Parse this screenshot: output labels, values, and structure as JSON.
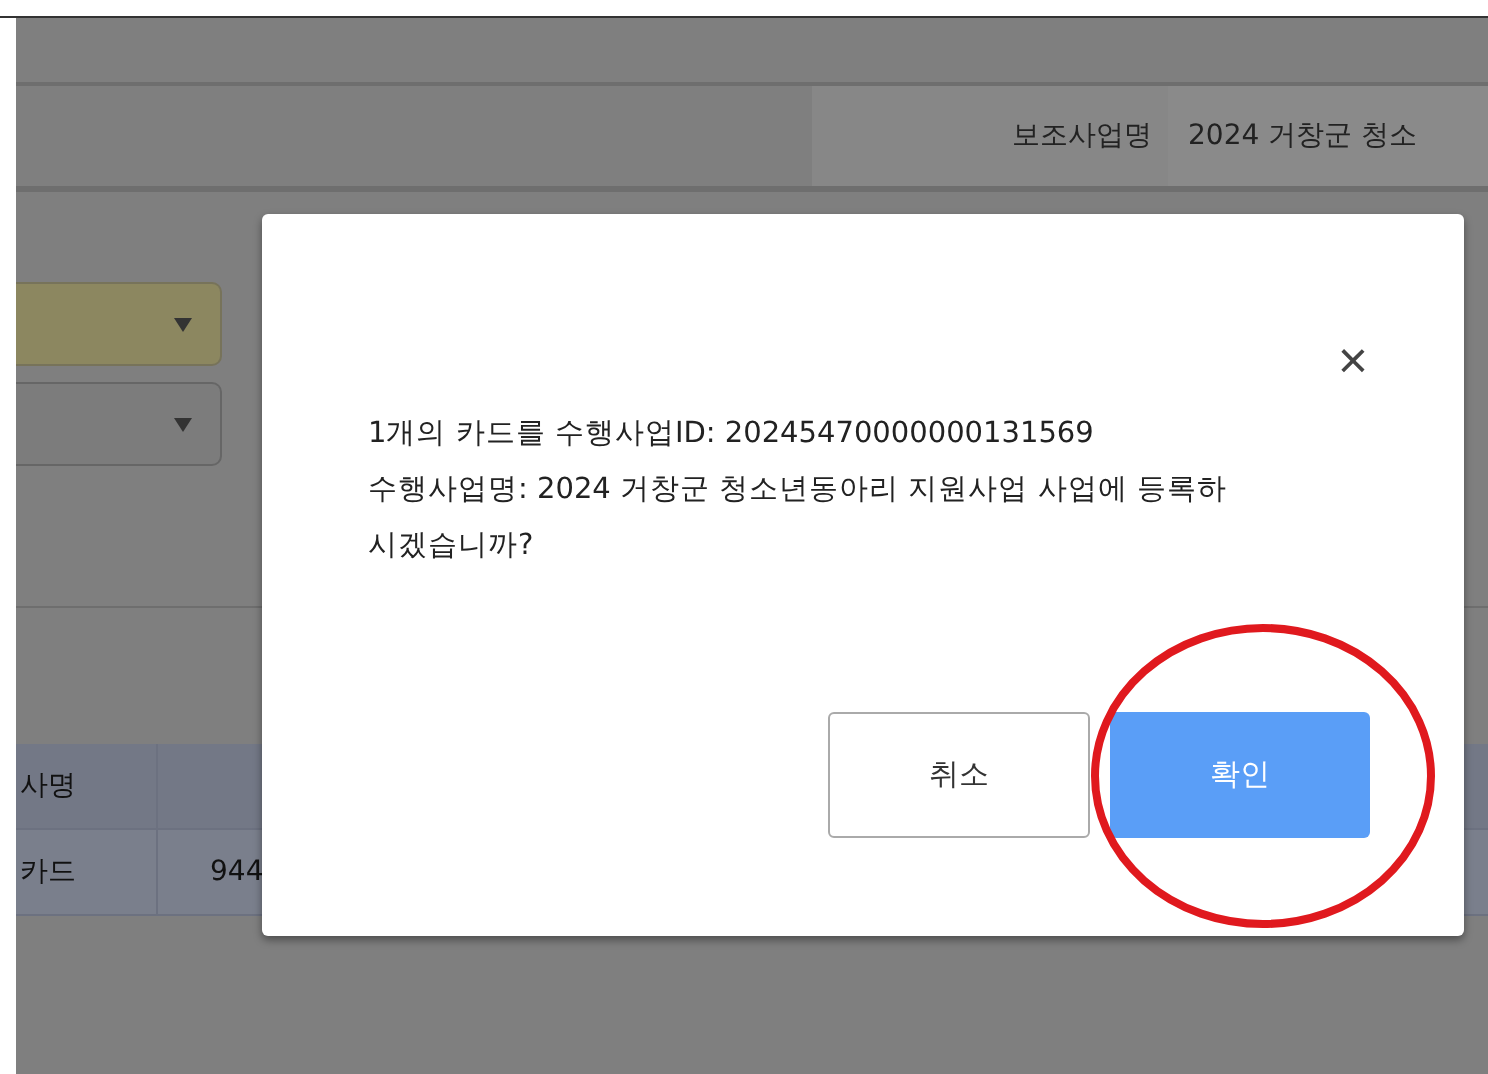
{
  "header": {
    "label": "보조사업명",
    "value": "2024 거창군 청소"
  },
  "selects": [
    {
      "highlighted": true
    },
    {
      "highlighted": false
    }
  ],
  "table": {
    "columns": [
      "사명"
    ],
    "rows": [
      [
        "카드",
        "944"
      ]
    ]
  },
  "dialog": {
    "lines": [
      "1개의 카드를 수행사업ID: 20245470000000131569",
      "수행사업명: 2024 거창군 청소년동아리 지원사업 사업에 등록하",
      "시겠습니까?"
    ],
    "close": "×",
    "buttons": [
      {
        "label": "취소",
        "primary": false
      },
      {
        "label": "확인",
        "primary": true,
        "circled": true
      }
    ]
  }
}
